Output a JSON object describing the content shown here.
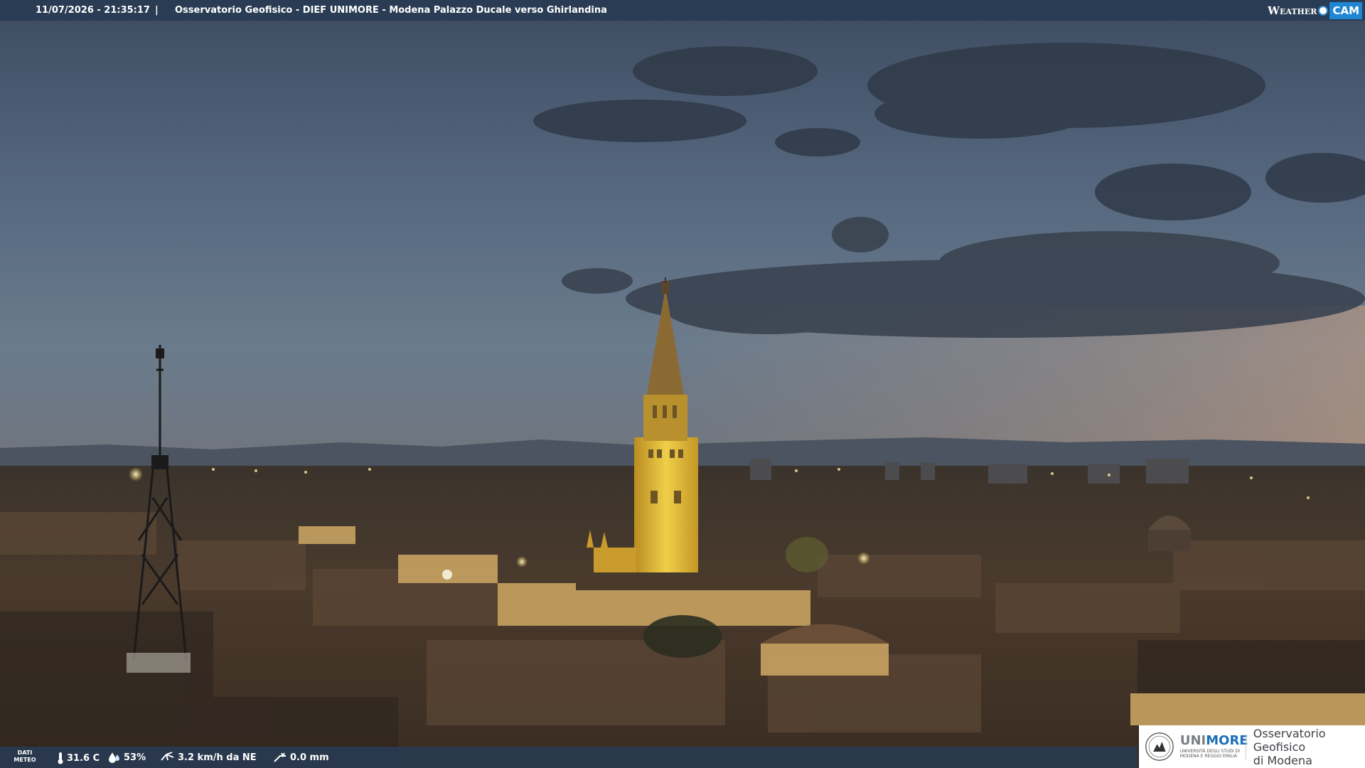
{
  "header": {
    "datetime": "11/07/2026 - 21:35:17",
    "separator": "|",
    "caption": "Osservatorio Geofisico - DIEF UNIMORE - Modena Palazzo Ducale verso Ghirlandina",
    "brand_weather": "Weather",
    "brand_cam": "CAM"
  },
  "meteo": {
    "tag_line1": "DATI",
    "tag_line2": "METEO",
    "temperature": "31.6 C",
    "humidity": "53%",
    "wind": "3.2 km/h da NE",
    "rain": "0.0 mm"
  },
  "logo": {
    "uni_part1": "UNI",
    "uni_part2": "MORE",
    "uni_sub_line1": "UNIVERSITÀ DEGLI STUDI DI",
    "uni_sub_line2": "MODENA E REGGIO EMILIA",
    "obs_line1": "Osservatorio Geofisico",
    "obs_line2": "di Modena"
  },
  "colors": {
    "bar_bg": "#283a52",
    "brand_blue": "#1f86d3",
    "uni_blue": "#1d6fb8",
    "tower_light": "#e8c23a"
  },
  "icons": {
    "temperature": "thermometer-icon",
    "humidity": "water-drop-icon",
    "wind": "wind-icon",
    "rain": "rain-gauge-icon"
  }
}
